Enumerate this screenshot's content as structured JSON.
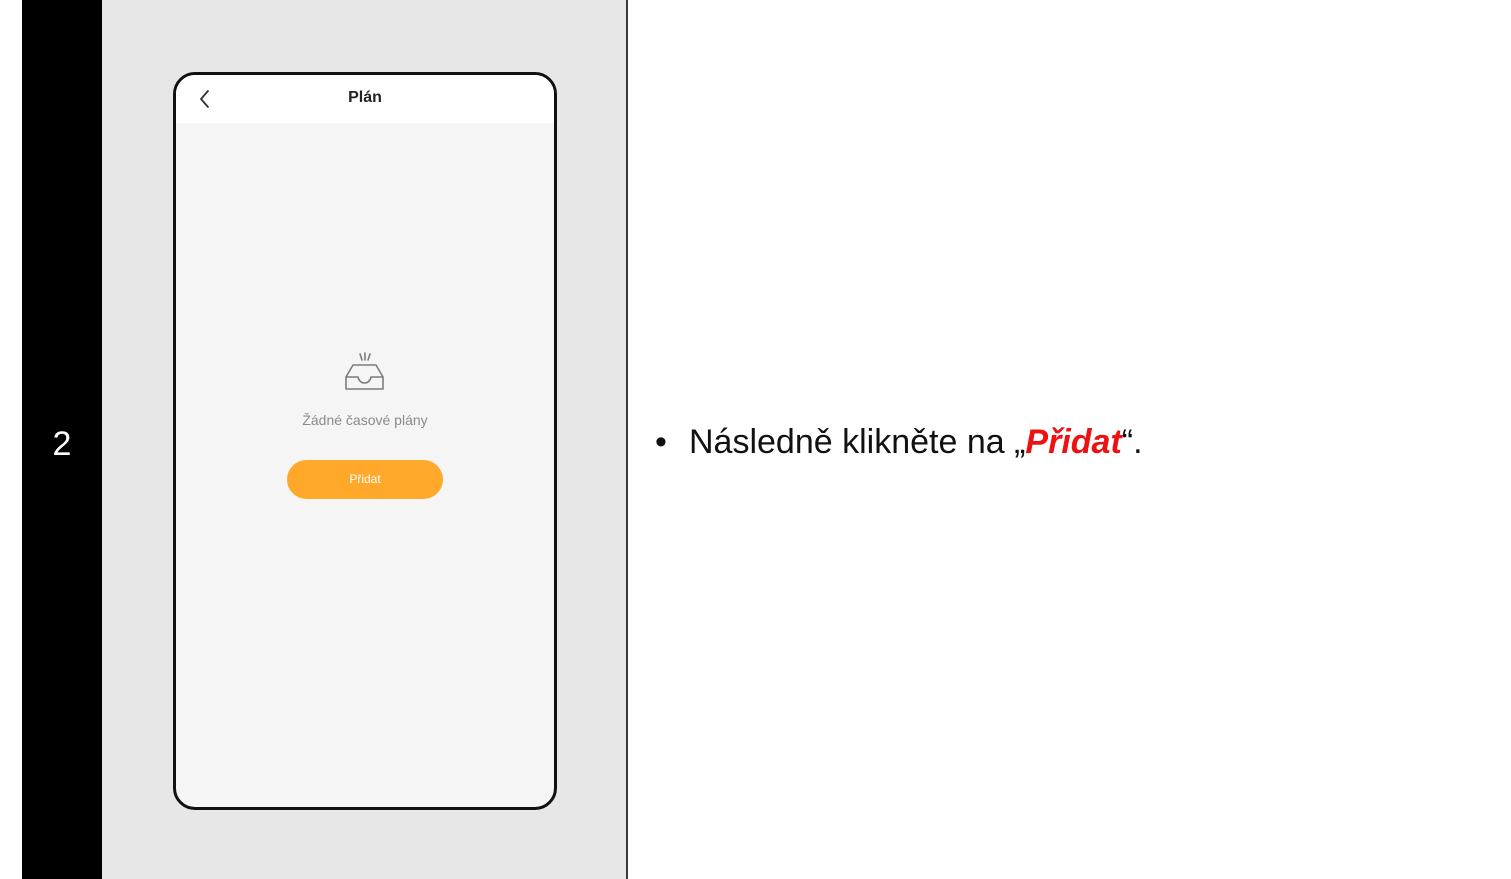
{
  "step": {
    "number": "2"
  },
  "phone_screen": {
    "title": "Plán",
    "back_icon": "chevron-left-icon",
    "empty_icon": "empty-inbox-icon",
    "empty_text": "Žádné časové plány",
    "add_button_label": "Přidat",
    "accent_color": "#ffa82a"
  },
  "instruction": {
    "bullet": "•",
    "text_before": "Následně klikněte na „",
    "highlight": "Přidat",
    "text_after": "“.",
    "highlight_color": "#ee1111"
  }
}
